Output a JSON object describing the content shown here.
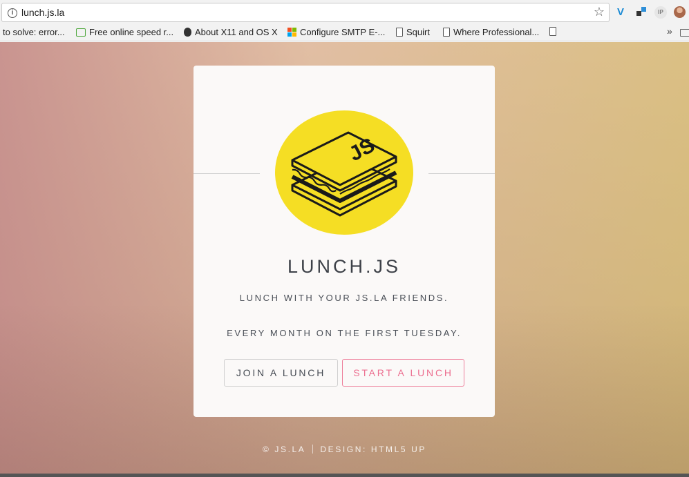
{
  "browser": {
    "url": "lunch.js.la",
    "bookmarks": [
      {
        "label": "to solve: error..."
      },
      {
        "label": "Free online speed r...",
        "icon": "book-icon"
      },
      {
        "label": "About X11 and OS X",
        "icon": "apple-icon"
      },
      {
        "label": "Configure SMTP E-...",
        "icon": "microsoft-icon"
      },
      {
        "label": "Squirt",
        "icon": "page-icon"
      },
      {
        "label": "Where Professional...",
        "icon": "page-icon"
      }
    ],
    "bookmarks_more": "»",
    "ext_ip_label": "IP",
    "ext_v_label": "V"
  },
  "card": {
    "title": "LUNCH.JS",
    "tagline1": "LUNCH WITH YOUR JS.LA FRIENDS.",
    "tagline2": "EVERY MONTH ON THE FIRST TUESDAY.",
    "join_button": "JOIN A LUNCH",
    "start_button": "START A LUNCH",
    "logo_text": "JS"
  },
  "footer": {
    "copyright": "© JS.LA",
    "design": "DESIGN: HTML5 UP"
  },
  "colors": {
    "logo_yellow": "#f5de24",
    "accent_pink": "#ec6f90",
    "text_dark": "#3d4148"
  }
}
